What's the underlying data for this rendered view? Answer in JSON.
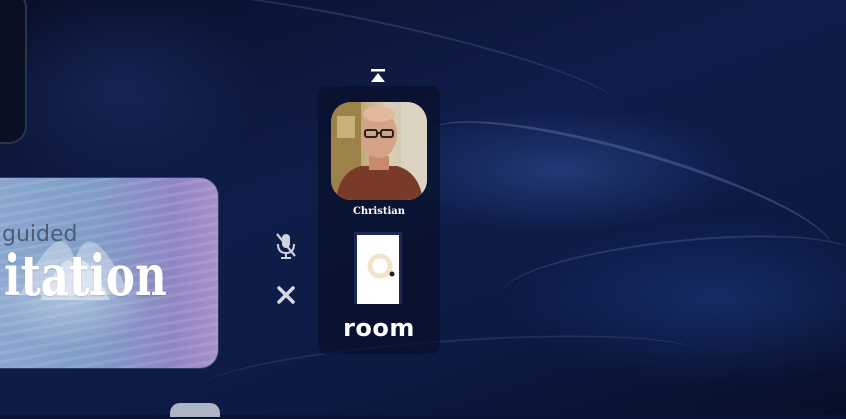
{
  "room_panel": {
    "participant": {
      "name": "Christian"
    },
    "room_label": "room"
  },
  "controls": {
    "collapse": {
      "icon": "collapse-up-icon"
    },
    "mic": {
      "icon": "microphone-muted-icon",
      "state": "muted"
    },
    "close": {
      "icon": "close-icon",
      "glyph": "✕"
    }
  },
  "left_card": {
    "title_small": "guided",
    "title_big": "itation"
  },
  "colors": {
    "background": "#0a1436",
    "panel": "#08102a",
    "text": "#ffffff",
    "door": "#ffffff"
  }
}
